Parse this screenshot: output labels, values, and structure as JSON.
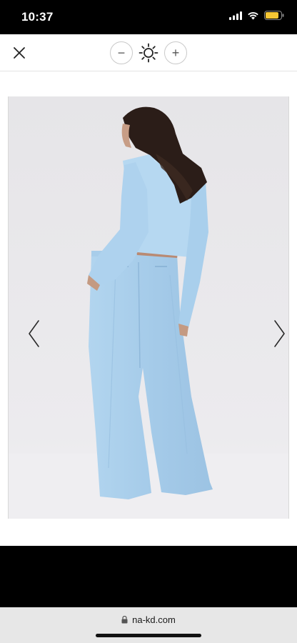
{
  "status_bar": {
    "time": "10:37"
  },
  "toolbar": {
    "minus_label": "−",
    "plus_label": "+"
  },
  "browser": {
    "url": "na-kd.com"
  },
  "colors": {
    "garment": "#a9cfec",
    "background": "#e9e8ea"
  }
}
